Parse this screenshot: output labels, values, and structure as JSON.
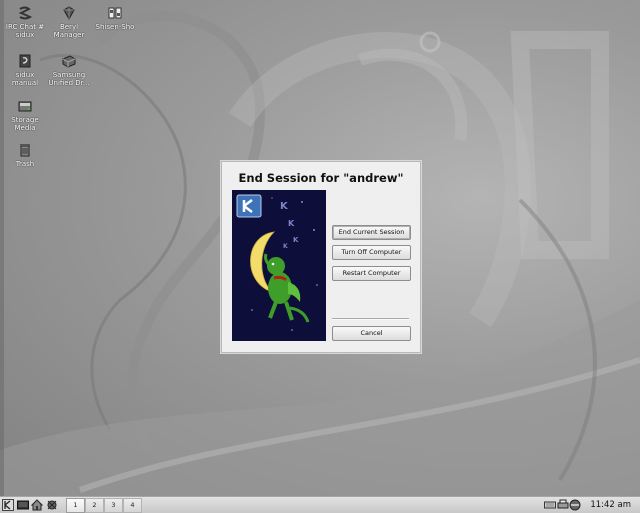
{
  "desktop": {
    "icons": [
      {
        "label": "IRC Chat # sidux",
        "icon": "irc-chat-icon"
      },
      {
        "label": "Beryl Manager",
        "icon": "beryl-icon"
      },
      {
        "label": "Shisen-Sho",
        "icon": "shisen-sho-icon"
      },
      {
        "label": "sidux manual",
        "icon": "manual-icon"
      },
      {
        "label": "Samsung Unified Dr...",
        "icon": "printer-driver-icon"
      },
      {
        "label": "Storage Media",
        "icon": "storage-icon"
      },
      {
        "label": "Trash",
        "icon": "trash-icon"
      }
    ]
  },
  "dialog": {
    "title": "End Session for \"andrew\"",
    "buttons": {
      "end_session": "End Current Session",
      "turn_off": "Turn Off Computer",
      "restart": "Restart Computer",
      "cancel": "Cancel"
    },
    "artwork_text": "K"
  },
  "taskbar": {
    "pager": [
      "1",
      "2",
      "3",
      "4"
    ],
    "active_desktop": "1",
    "clock": "11:42 am",
    "launchers": [
      "kmenu-icon",
      "terminal-icon",
      "home-icon",
      "konqueror-icon"
    ],
    "tray": [
      "keyboard-icon",
      "printer-tray-icon",
      "network-icon",
      "power-icon"
    ]
  },
  "colors": {
    "desktop_bg": "#9a9a9a",
    "dialog_bg": "#efefef",
    "art_bg": "#0d0e3a",
    "moon": "#f2dd6a",
    "dragon": "#3f9e2a"
  }
}
